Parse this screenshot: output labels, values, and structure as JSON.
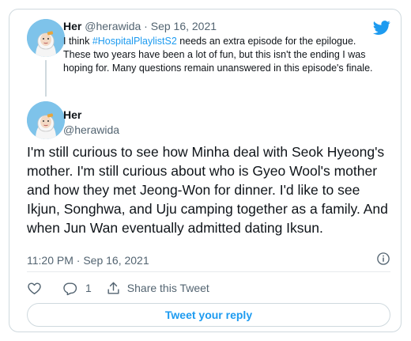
{
  "quoted": {
    "name": "Her",
    "handle": "@herawida",
    "separator": "·",
    "date": "Sep 16, 2021",
    "text_before": "I think ",
    "hashtag": "#HospitalPlaylistS2",
    "text_after": " needs an extra episode for the epilogue. These two years have been a lot of fun, but this isn't the ending I was hoping for. Many questions remain unanswered in this episode's finale."
  },
  "tweet": {
    "name": "Her",
    "handle": "@herawida",
    "text": "I'm still curious to see how Minha deal with Seok Hyeong's mother. I'm still curious about who is Gyeo Wool's mother and how they met Jeong-Won for dinner. I'd like to see Ikjun, Songhwa, and Uju camping together as a family. And when Jun Wan eventually admitted dating Iksun.",
    "timestamp": "11:20 PM · Sep 16, 2021"
  },
  "actions": {
    "reply_count": "1",
    "share_label": "Share this Tweet"
  },
  "reply_button": "Tweet your reply",
  "colors": {
    "accent": "#1d9bf0",
    "secondary_text": "#536471",
    "border": "#cfd9de",
    "avatar_bg": "#7ec3ea"
  },
  "icons": [
    "twitter-bird-icon",
    "info-icon",
    "like-heart-icon",
    "reply-bubble-icon",
    "share-icon"
  ]
}
